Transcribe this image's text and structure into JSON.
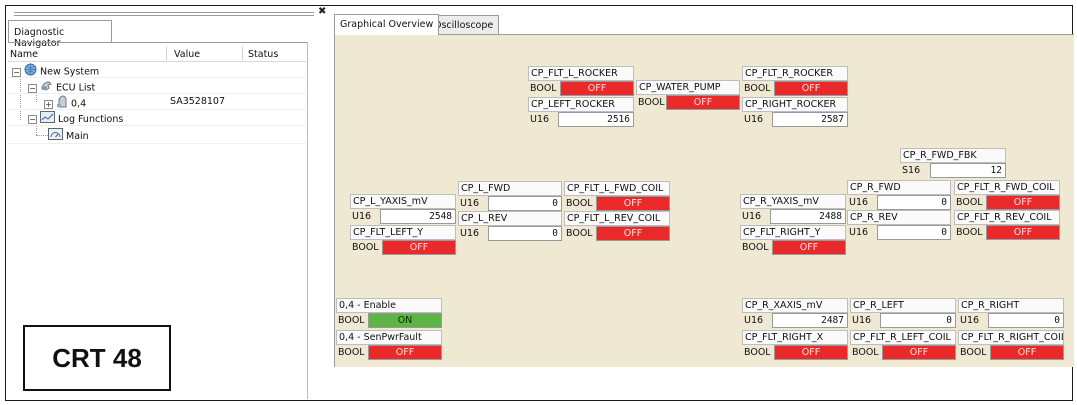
{
  "colors": {
    "on": "#5cb544",
    "off": "#ea2a2a",
    "canvas": "#efe9d4"
  },
  "navigator": {
    "tab_label": "Diagnostic Navigator",
    "columns": {
      "name": "Name",
      "value": "Value",
      "status": "Status"
    },
    "tree": [
      {
        "label": "New System",
        "icon": "globe-icon",
        "expander": "−",
        "value": ""
      },
      {
        "label": "ECU List",
        "icon": "ecu-list-icon",
        "expander": "−",
        "value": ""
      },
      {
        "label": "0,4",
        "icon": "ecu-icon",
        "expander": "+",
        "value": "SA3528107"
      },
      {
        "label": "Log Functions",
        "icon": "log-functions-icon",
        "expander": "−",
        "value": ""
      },
      {
        "label": "Main",
        "icon": "gauge-icon",
        "expander": "",
        "value": ""
      }
    ]
  },
  "tabs": [
    {
      "label": "Graphical Overview",
      "active": true
    },
    {
      "label": "Oscilloscope",
      "active": false
    }
  ],
  "signals": {
    "cp_flt_l_rocker": {
      "name": "CP_FLT_L_ROCKER",
      "type": "BOOL",
      "value": "OFF",
      "state": "off"
    },
    "cp_water_pump": {
      "name": "CP_WATER_PUMP",
      "type": "BOOL",
      "value": "OFF",
      "state": "off"
    },
    "cp_flt_r_rocker": {
      "name": "CP_FLT_R_ROCKER",
      "type": "BOOL",
      "value": "OFF",
      "state": "off"
    },
    "cp_left_rocker": {
      "name": "CP_LEFT_ROCKER",
      "type": "U16",
      "value": "2516"
    },
    "cp_right_rocker": {
      "name": "CP_RIGHT_ROCKER",
      "type": "U16",
      "value": "2587"
    },
    "cp_r_fwd_fbk": {
      "name": "CP_R_FWD_FBK",
      "type": "S16",
      "value": "12"
    },
    "cp_l_fwd": {
      "name": "CP_L_FWD",
      "type": "U16",
      "value": "0"
    },
    "cp_flt_l_fwd_coil": {
      "name": "CP_FLT_L_FWD_COIL",
      "type": "BOOL",
      "value": "OFF",
      "state": "off"
    },
    "cp_l_yaxis_mv": {
      "name": "CP_L_YAXIS_mV",
      "type": "U16",
      "value": "2548"
    },
    "cp_l_rev": {
      "name": "CP_L_REV",
      "type": "U16",
      "value": "0"
    },
    "cp_flt_l_rev_coil": {
      "name": "CP_FLT_L_REV_COIL",
      "type": "BOOL",
      "value": "OFF",
      "state": "off"
    },
    "cp_flt_left_y": {
      "name": "CP_FLT_LEFT_Y",
      "type": "BOOL",
      "value": "OFF",
      "state": "off"
    },
    "cp_r_fwd": {
      "name": "CP_R_FWD",
      "type": "U16",
      "value": "0"
    },
    "cp_flt_r_fwd_coil": {
      "name": "CP_FLT_R_FWD_COIL",
      "type": "BOOL",
      "value": "OFF",
      "state": "off"
    },
    "cp_r_yaxis_mv": {
      "name": "CP_R_YAXIS_mV",
      "type": "U16",
      "value": "2488"
    },
    "cp_r_rev": {
      "name": "CP_R_REV",
      "type": "U16",
      "value": "0"
    },
    "cp_flt_r_rev_coil": {
      "name": "CP_FLT_R_REV_COIL",
      "type": "BOOL",
      "value": "OFF",
      "state": "off"
    },
    "cp_flt_right_y": {
      "name": "CP_FLT_RIGHT_Y",
      "type": "BOOL",
      "value": "OFF",
      "state": "off"
    },
    "enable": {
      "name": "0,4 - Enable",
      "type": "BOOL",
      "value": "ON",
      "state": "on"
    },
    "senpwrfault": {
      "name": "0,4 - SenPwrFault",
      "type": "BOOL",
      "value": "OFF",
      "state": "off"
    },
    "cp_r_xaxis_mv": {
      "name": "CP_R_XAXIS_mV",
      "type": "U16",
      "value": "2487"
    },
    "cp_r_left": {
      "name": "CP_R_LEFT",
      "type": "U16",
      "value": "0"
    },
    "cp_r_right": {
      "name": "CP_R_RIGHT",
      "type": "U16",
      "value": "0"
    },
    "cp_flt_right_x": {
      "name": "CP_FLT_RIGHT_X",
      "type": "BOOL",
      "value": "OFF",
      "state": "off"
    },
    "cp_flt_r_left_coil": {
      "name": "CP_FLT_R_LEFT_COIL",
      "type": "BOOL",
      "value": "OFF",
      "state": "off"
    },
    "cp_flt_r_right_coil": {
      "name": "CP_FLT_R_RIGHT_COIL",
      "type": "BOOL",
      "value": "OFF",
      "state": "off"
    }
  },
  "figure_label": "CRT 48"
}
